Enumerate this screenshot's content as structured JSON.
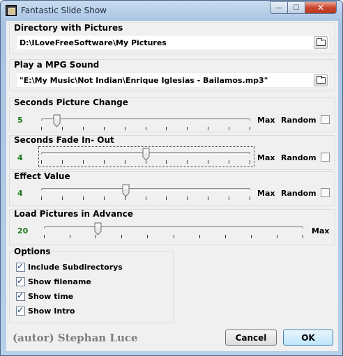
{
  "window": {
    "title": "Fantastic Slide Show",
    "minimize_glyph": "—",
    "maximize_glyph": "☐",
    "close_glyph": "✕"
  },
  "directory": {
    "title": "Directory with Pictures",
    "value": "D:\\ILoveFreeSoftware\\My Pictures",
    "button_icon": "folder-open-icon"
  },
  "sound": {
    "title": "Play a MPG Sound",
    "value": "\"E:\\My Music\\Not Indian\\Enrique Iglesias - Bailamos.mp3\"",
    "button_icon": "folder-open-icon"
  },
  "sliders": [
    {
      "title": "Seconds Picture Change",
      "value": "5",
      "position": 0.06,
      "max_label": "Max",
      "random_label": "Random",
      "random_checked": false
    },
    {
      "title": "Seconds Fade In- Out",
      "value": "4",
      "position": 0.5,
      "max_label": "Max",
      "random_label": "Random",
      "random_checked": false
    },
    {
      "title": "Effect Value",
      "value": "4",
      "position": 0.4,
      "max_label": "Max",
      "random_label": "Random",
      "random_checked": false
    }
  ],
  "preload": {
    "title": "Load Pictures in Advance",
    "value": "20",
    "position": 0.2,
    "max_label": "Max"
  },
  "options": {
    "title": "Options",
    "items": [
      {
        "label": "Include Subdirectorys",
        "checked": true
      },
      {
        "label": "Show filename",
        "checked": true
      },
      {
        "label": "Show time",
        "checked": true
      },
      {
        "label": "Show Intro",
        "checked": true
      }
    ]
  },
  "footer": {
    "author": "(autor) Stephan Luce",
    "cancel_label": "Cancel",
    "ok_label": "OK"
  },
  "colors": {
    "value_green": "#1a7a1a",
    "title_blue": "#a9c4e3"
  }
}
